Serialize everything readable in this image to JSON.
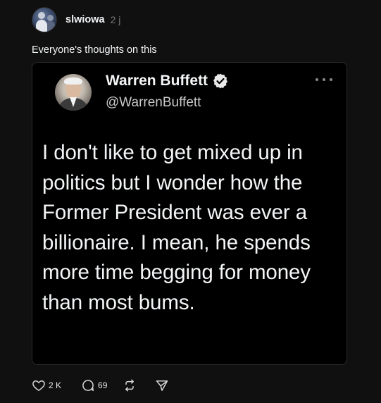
{
  "post": {
    "username": "slwiowa",
    "timestamp": "2 j",
    "caption": "Everyone's thoughts on this"
  },
  "tweet": {
    "name": "Warren Buffett",
    "handle": "@WarrenBuffett",
    "text": "I don't like to get mixed up in politics but I wonder how the Former President was ever a billionaire. I mean, he spends more time begging for money than most bums."
  },
  "actions": {
    "like_count": "2 K",
    "reply_count": "69"
  },
  "icons": {
    "like": "heart-icon",
    "reply": "comment-icon",
    "repost": "repost-icon",
    "share": "send-icon",
    "verified": "verified-badge-icon",
    "more": "more-dots-icon"
  },
  "colors": {
    "background": "#101010",
    "text_primary": "#f3f5f7",
    "text_secondary": "#777777"
  }
}
